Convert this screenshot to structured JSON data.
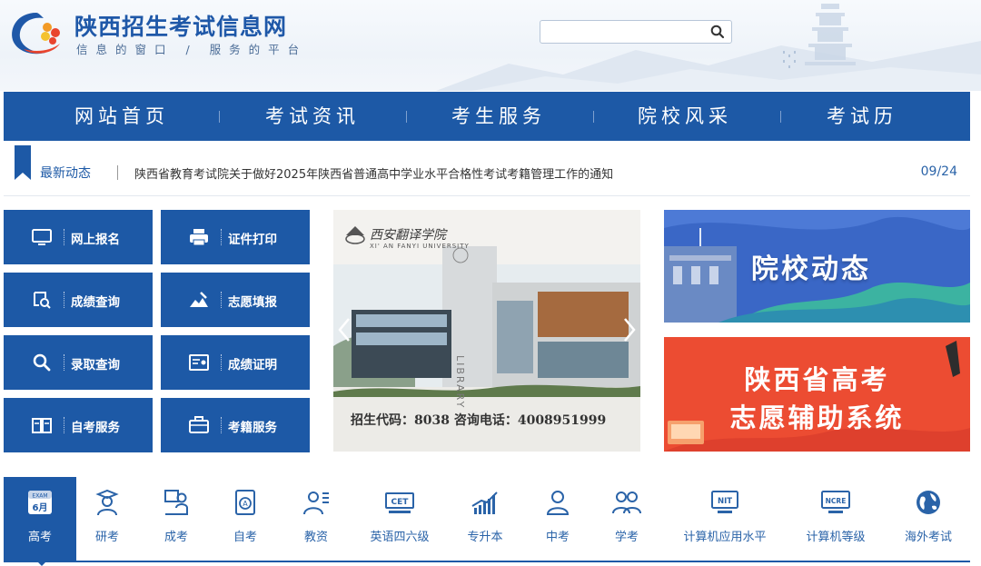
{
  "header": {
    "title": "陕西招生考试信息网",
    "slogan": "信息的窗口 / 服务的平台",
    "search_placeholder": "",
    "search_icon": "search-icon"
  },
  "nav": {
    "items": [
      "网站首页",
      "考试资讯",
      "考生服务",
      "院校风采",
      "考试历"
    ]
  },
  "news": {
    "label": "最新动态",
    "headline": "陕西省教育考试院关于做好2025年陕西省普通高中学业水平合格性考试考籍管理工作的通知",
    "date": "09/24"
  },
  "quick_links": [
    {
      "label": "网上报名",
      "icon": "monitor-icon"
    },
    {
      "label": "证件打印",
      "icon": "printer-icon"
    },
    {
      "label": "成绩查询",
      "icon": "score-search-icon"
    },
    {
      "label": "志愿填报",
      "icon": "form-fill-icon"
    },
    {
      "label": "录取查询",
      "icon": "search-icon"
    },
    {
      "label": "成绩证明",
      "icon": "certificate-icon"
    },
    {
      "label": "自考服务",
      "icon": "book-icon"
    },
    {
      "label": "考籍服务",
      "icon": "briefcase-icon"
    }
  ],
  "carousel": {
    "school_name": "西安翻译学院",
    "school_name_en": "XI' AN FANYI UNIVERSITY",
    "building_sign": "LIBRARY",
    "caption": "招生代码：8038  咨询电话：4008951999"
  },
  "banners": {
    "campus_news": "院校动态",
    "gaokao_line1": "陕西省高考",
    "gaokao_line2": "志愿辅助系统"
  },
  "categories": [
    {
      "label": "高考",
      "icon": "calendar-exam-icon",
      "badge_top": "EXAM",
      "badge_bottom": "6月",
      "active": true
    },
    {
      "label": "研考",
      "icon": "graduate-icon"
    },
    {
      "label": "成考",
      "icon": "adult-exam-icon"
    },
    {
      "label": "自考",
      "icon": "self-study-icon"
    },
    {
      "label": "教资",
      "icon": "teacher-icon"
    },
    {
      "label": "英语四六级",
      "icon": "cet-icon",
      "badge": "CET"
    },
    {
      "label": "专升本",
      "icon": "growth-chart-icon"
    },
    {
      "label": "中考",
      "icon": "student-icon"
    },
    {
      "label": "学考",
      "icon": "students-group-icon"
    },
    {
      "label": "计算机应用水平",
      "icon": "nit-icon",
      "badge": "NIT"
    },
    {
      "label": "计算机等级",
      "icon": "ncre-icon",
      "badge": "NCRE"
    },
    {
      "label": "海外考试",
      "icon": "globe-icon"
    }
  ],
  "colors": {
    "primary": "#1d59a6",
    "banner_red": "#e8442e",
    "banner_blue": "#3a67c6"
  }
}
